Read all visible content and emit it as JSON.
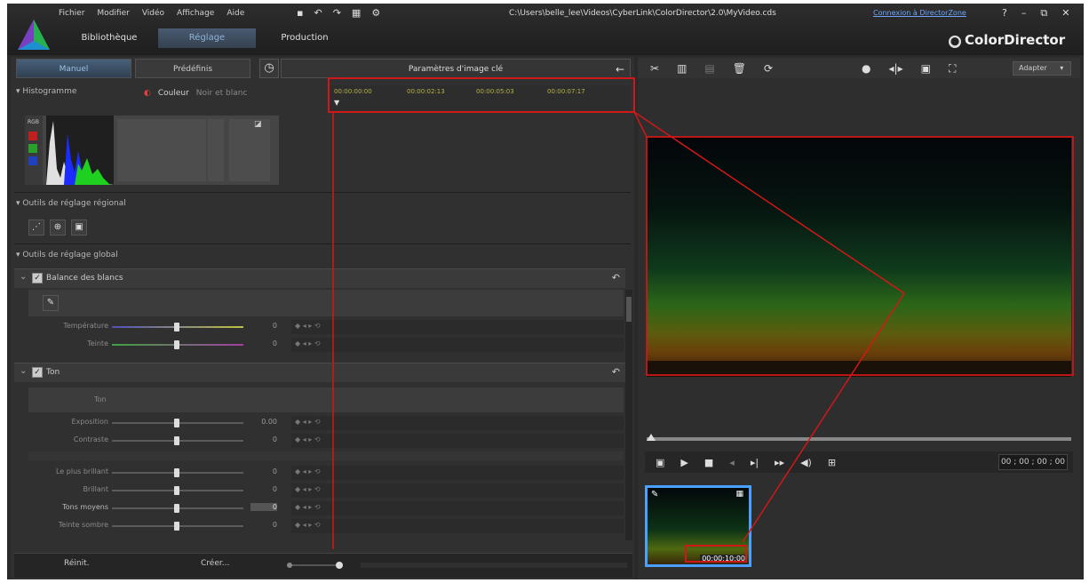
{
  "menu": [
    "Fichier",
    "Modifier",
    "Vidéo",
    "Affichage",
    "Aide"
  ],
  "title_path": "C:\\Users\\belle_lee\\Videos\\CyberLink\\ColorDirector\\2.0\\MyVideo.cds",
  "connection_link": "Connexion à DirectorZone",
  "window_controls": [
    "?",
    "–",
    "⧉",
    "✕"
  ],
  "mode_tabs": [
    "Bibliothèque",
    "Réglage",
    "Production"
  ],
  "brand": "ColorDirector",
  "left": {
    "subtabs": [
      "Manuel",
      "Prédéfinis"
    ],
    "keyframe_title": "Paramètres d'image clé",
    "histogram": {
      "label": "Histogramme",
      "color": "Couleur",
      "bw": "Noir et blanc",
      "rgb": "RGB"
    },
    "keyframe_times": [
      "00:00:00:00",
      "00:00:02:13",
      "00:00:05:03",
      "00:00:07:17"
    ],
    "regional_tools": "Outils de réglage régional",
    "global_tools": "Outils de réglage global",
    "white_balance": {
      "label": "Balance des blancs",
      "rows": [
        {
          "label": "Température",
          "value": "0"
        },
        {
          "label": "Teinte",
          "value": "0"
        }
      ]
    },
    "tone": {
      "label": "Ton",
      "sublabel": "Ton",
      "rows": [
        {
          "label": "Exposition",
          "value": "0.00"
        },
        {
          "label": "Contraste",
          "value": "0"
        },
        {
          "label": "Le plus brillant",
          "value": "0"
        },
        {
          "label": "Brillant",
          "value": "0"
        },
        {
          "label": "Tons moyens",
          "value": "0"
        },
        {
          "label": "Teinte sombre",
          "value": "0"
        }
      ]
    },
    "kf_row_text": "◆ ◂ ▸ ⟲",
    "bottom": {
      "reset": "Réinit.",
      "create": "Créer..."
    }
  },
  "right": {
    "adapt": "Adapter",
    "timecode": "00 ; 00 ; 00 ; 00",
    "thumb_time": "00;00;10;00"
  },
  "colors": {
    "accent": "#4aa0ff",
    "annotation": "#d01818"
  }
}
